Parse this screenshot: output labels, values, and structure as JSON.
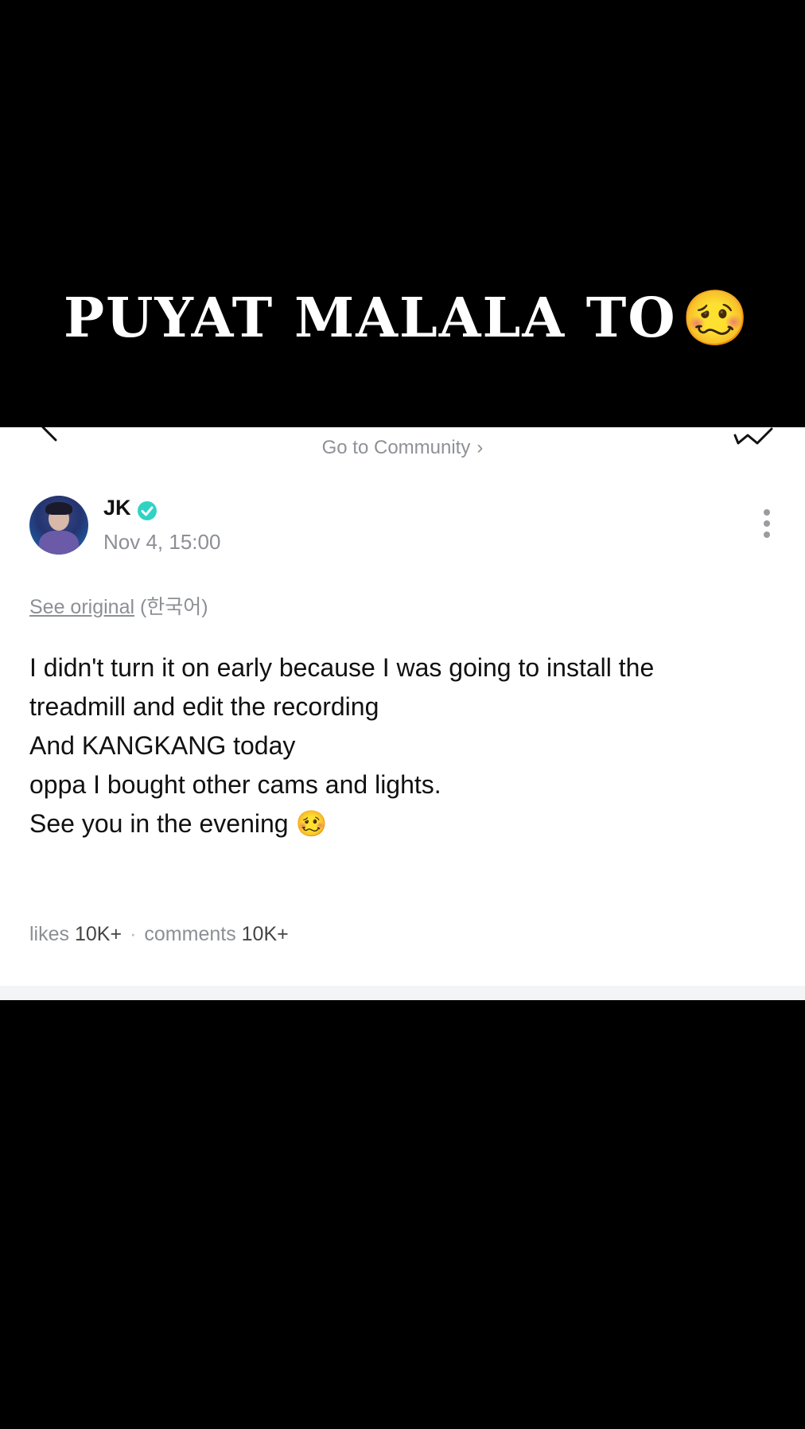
{
  "caption": {
    "text": "PUYAT MALALA TO",
    "emoji": "🥴"
  },
  "nav": {
    "back_icon": "chevron-left-icon",
    "community_link": "Go to Community",
    "community_chevron": "›",
    "share_icon": "share-icon"
  },
  "post": {
    "author": "JK",
    "verified_icon": "verified-badge-icon",
    "timestamp": "Nov 4, 15:00",
    "see_original_link": "See original",
    "see_original_lang": "(한국어)",
    "body_lines": [
      "I didn't turn it on early because I was going to install the",
      "treadmill and edit the recording",
      "And KANGKANG today",
      "oppa I bought other cams and lights.",
      "See you in the evening 🥴"
    ],
    "likes_label": "likes",
    "likes_count": "10K+",
    "separator": "·",
    "comments_label": "comments",
    "comments_count": "10K+"
  },
  "colors": {
    "background": "#000000",
    "panel": "#ffffff",
    "verified": "#2fd3c4",
    "muted_text": "#8c8f94"
  }
}
